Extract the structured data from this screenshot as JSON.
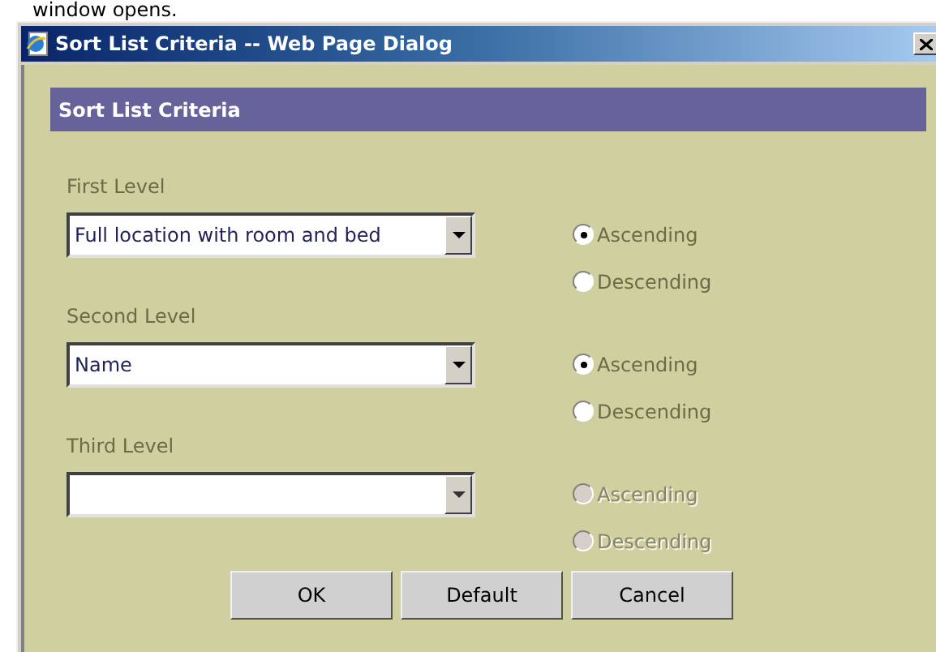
{
  "top_text": "window opens.",
  "window": {
    "title": "Sort List Criteria -- Web Page Dialog"
  },
  "header": "Sort List Criteria",
  "levels": [
    {
      "label": "First Level",
      "value": "Full location with room and bed",
      "disabled": false,
      "order": [
        {
          "label": "Ascending",
          "selected": true
        },
        {
          "label": "Descending",
          "selected": false
        }
      ]
    },
    {
      "label": "Second Level",
      "value": "Name",
      "disabled": false,
      "order": [
        {
          "label": "Ascending",
          "selected": true
        },
        {
          "label": "Descending",
          "selected": false
        }
      ]
    },
    {
      "label": "Third Level",
      "disabled": true,
      "order": [
        {
          "label": "Ascending",
          "selected": false
        },
        {
          "label": "Descending",
          "selected": false
        }
      ]
    }
  ],
  "buttons": [
    "OK",
    "Default",
    "Cancel"
  ]
}
